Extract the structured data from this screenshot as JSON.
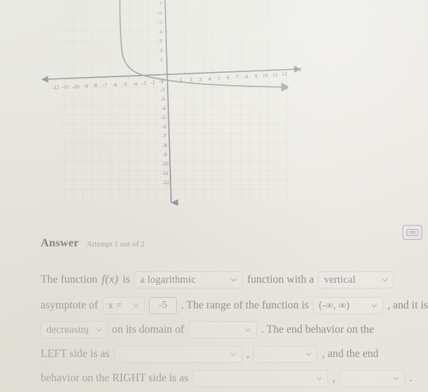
{
  "graph": {
    "x_axis_label": "x",
    "x_ticks_negative": [
      "-12",
      "-11",
      "-10",
      "-9",
      "-8",
      "-7",
      "-6",
      "-5",
      "-4",
      "-3",
      "-2",
      "-1"
    ],
    "x_ticks_positive": [
      "1",
      "2",
      "3",
      "4",
      "5",
      "6",
      "7",
      "8",
      "9",
      "10",
      "11",
      "12"
    ],
    "y_ticks_positive": [
      "7",
      "6",
      "5",
      "4",
      "3",
      "2",
      "1"
    ],
    "y_ticks_negative": [
      "-1",
      "-2",
      "-3",
      "-4",
      "-5",
      "-6",
      "-7",
      "-8",
      "-9",
      "-10",
      "-11",
      "-12"
    ],
    "curve_color": "#7d8a80",
    "axis_color": "#6e6a86",
    "grid_color": "#ded5d0"
  },
  "answer": {
    "title": "Answer",
    "attempt": "Attempt 1 out of 2",
    "calculator_icon": "calculator-icon"
  },
  "prompt": {
    "t1": "The function",
    "fn": "f(x)",
    "t2": "is",
    "t3": "function with a",
    "t4": "asymptote of",
    "t5": ". The range of the function is",
    "t6": ", and it is",
    "t7": "on its domain of",
    "t8": ". The end behavior on the",
    "t9": "LEFT side is as",
    "t10": ",",
    "t11": ", and the end",
    "t12": "behavior on the RIGHT side is as",
    "t13": ",",
    "t14": "."
  },
  "fields": {
    "function_type": "a logarithmic",
    "asymptote_direction": "vertical",
    "asymptote_var": "x =",
    "asymptote_value": "-5",
    "range": "(-∞, ∞)",
    "monotonicity": "decreasing",
    "domain": "",
    "left_end_input": "",
    "left_end_output": "",
    "right_end_input": "",
    "right_end_output": ""
  }
}
